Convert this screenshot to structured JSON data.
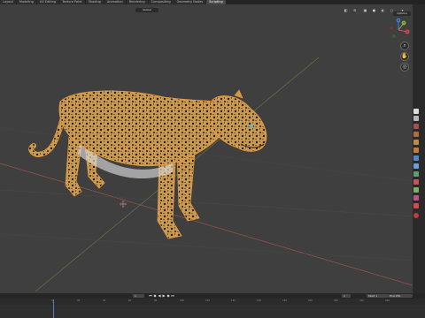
{
  "workspace_tabs": [
    "Layout",
    "Modeling",
    "UV Editing",
    "Texture Paint",
    "Shading",
    "Animation",
    "Rendering",
    "Compositing",
    "Geometry Nodes",
    "Scripting"
  ],
  "active_tab_index": 9,
  "viewport": {
    "mode": "Global",
    "options_label": "Options",
    "gizmo_axes": {
      "x": "X",
      "y": "Y",
      "z": "Z"
    },
    "colors": {
      "background": "#3f3f3f",
      "x_axis": "#a0554f",
      "y_axis": "#7c9548",
      "leopard_base": "#c99a52",
      "selection_outline": "#e89a3a"
    }
  },
  "timeline": {
    "start_label": "Start",
    "start_value": "1",
    "end_label": "End",
    "end_value": "250",
    "current_frame": "1",
    "tick_labels": [
      "0",
      "20",
      "40",
      "60",
      "80",
      "100",
      "120",
      "140",
      "160",
      "180",
      "200",
      "220",
      "240",
      "260"
    ]
  },
  "icons": [
    "rewind-icon",
    "prev-keyframe-icon",
    "play-reverse-icon",
    "play-icon",
    "next-keyframe-icon",
    "fast-forward-icon"
  ]
}
